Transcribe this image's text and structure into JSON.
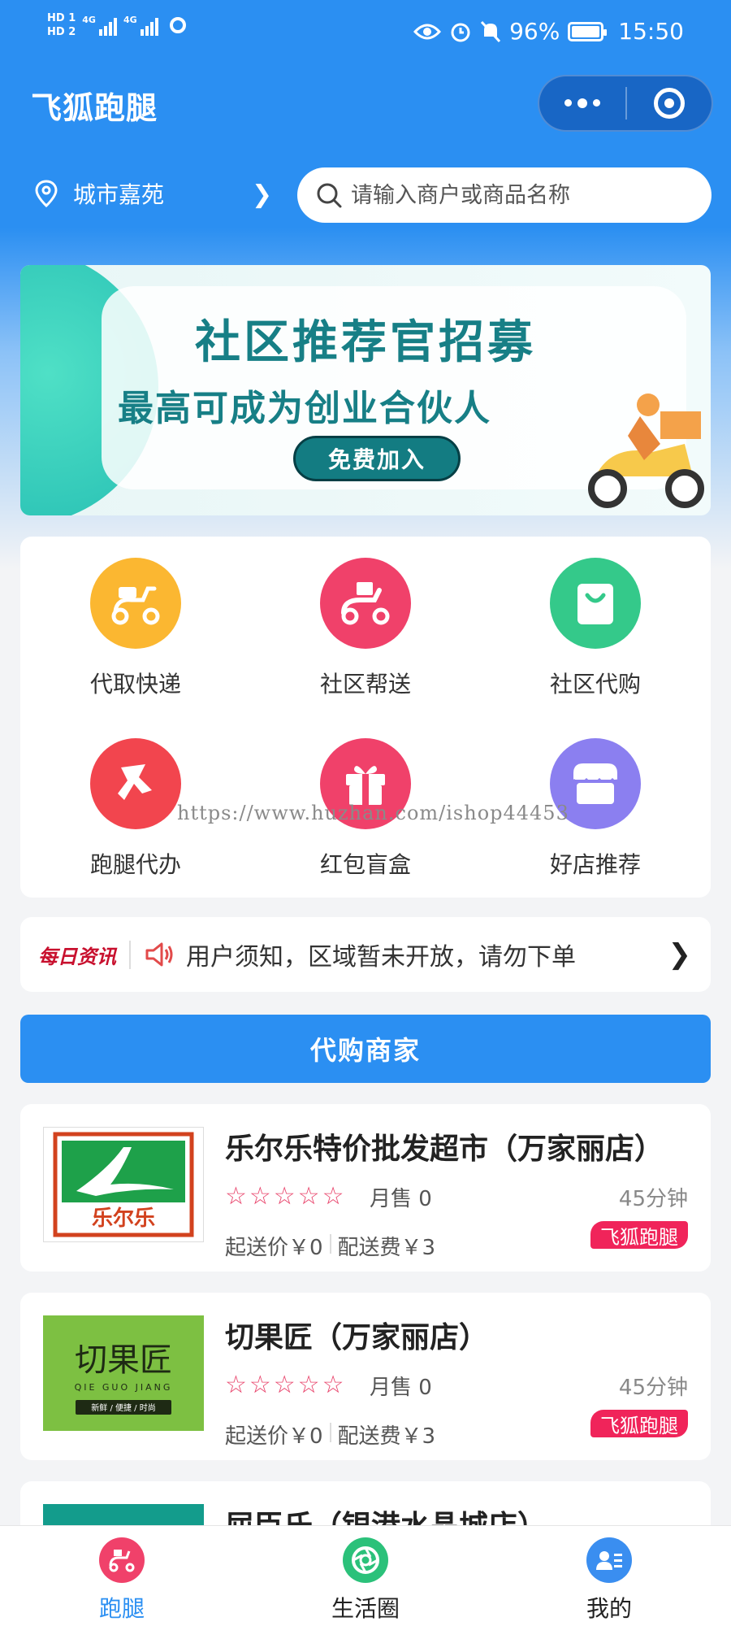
{
  "status_bar": {
    "hd1": "HD 1",
    "hd2": "HD 2",
    "net1": "4G",
    "net2": "4G",
    "battery": "96%",
    "time": "15:50"
  },
  "header": {
    "title": "飞狐跑腿",
    "location": "城市嘉苑",
    "search_placeholder": "请输入商户或商品名称"
  },
  "banner": {
    "title": "社区推荐官招募",
    "subtitle": "最高可成为创业合伙人",
    "button": "免费加入"
  },
  "services": [
    {
      "label": "代取快递",
      "icon": "scooter-icon",
      "color": "#fbb731"
    },
    {
      "label": "社区帮送",
      "icon": "delivery-scooter-icon",
      "color": "#f0416a"
    },
    {
      "label": "社区代购",
      "icon": "shopping-bag-icon",
      "color": "#34c98a"
    },
    {
      "label": "跑腿代办",
      "icon": "runner-icon",
      "color": "#f2454e"
    },
    {
      "label": "红包盲盒",
      "icon": "gift-box-icon",
      "color": "#f0416a"
    },
    {
      "label": "好店推荐",
      "icon": "storefront-icon",
      "color": "#8b7ff0"
    }
  ],
  "watermark": "https://www.huzhan.com/ishop44453",
  "news": {
    "tag": "每日资讯",
    "text": "用户须知，区域暂未开放，请勿下单"
  },
  "section_title": "代购商家",
  "merchants": [
    {
      "name": "乐尔乐特价批发超市（万家丽店）",
      "stars": "☆☆☆☆☆",
      "sales": "月售 0",
      "time": "45分钟",
      "min_order": "起送价￥0",
      "delivery_fee": "配送费￥3",
      "badge": "飞狐跑腿",
      "logo_text": "乐尔乐"
    },
    {
      "name": "切果匠（万家丽店）",
      "stars": "☆☆☆☆☆",
      "sales": "月售 0",
      "time": "45分钟",
      "min_order": "起送价￥0",
      "delivery_fee": "配送费￥3",
      "badge": "飞狐跑腿",
      "logo_text": "切果匠",
      "logo_sub": "QIE GUO JIANG",
      "logo_tag": "新鲜 / 便捷 / 时尚"
    },
    {
      "name": "屈臣氏（银港水晶城店）"
    }
  ],
  "tabbar": [
    {
      "label": "跑腿",
      "icon": "errand-tab-icon",
      "active": true
    },
    {
      "label": "生活圈",
      "icon": "aperture-icon",
      "active": false
    },
    {
      "label": "我的",
      "icon": "profile-card-icon",
      "active": false
    }
  ]
}
